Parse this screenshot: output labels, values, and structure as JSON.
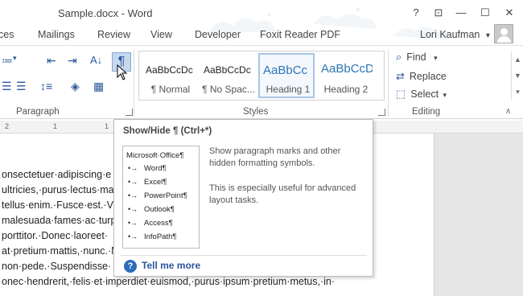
{
  "window": {
    "title": "Sample.docx - Word",
    "help": "?",
    "restore": "⊡",
    "minimize": "—",
    "maximize": "☐",
    "close": "✕"
  },
  "tabs": [
    "ces",
    "Mailings",
    "Review",
    "View",
    "Developer",
    "Foxit Reader PDF"
  ],
  "user": {
    "name": "Lori Kaufman",
    "dropdown": "▾"
  },
  "ribbon": {
    "paragraph_label": "Paragraph",
    "styles_label": "Styles",
    "editing_label": "Editing",
    "pilcrow": "¶",
    "styles": [
      {
        "sample": "AaBbCcDc",
        "name": "¶ Normal"
      },
      {
        "sample": "AaBbCcDc",
        "name": "¶ No Spac..."
      },
      {
        "sample": "AaBbCc",
        "name": "Heading 1"
      },
      {
        "sample": "AaBbCcD",
        "name": "Heading 2"
      }
    ],
    "editing": [
      {
        "icon": "find-icon",
        "label": "Find",
        "arrow": "▾"
      },
      {
        "icon": "replace-icon",
        "label": "Replace"
      },
      {
        "icon": "select-icon",
        "label": "Select",
        "arrow": "▾"
      }
    ]
  },
  "ruler": {
    "marks": [
      "2",
      "1",
      "1"
    ]
  },
  "document": {
    "lines": [
      "onsectetuer·adipiscing·e",
      "ultricies,·purus·lectus·ma",
      "tellus·enim.·Fusce·est.·Viva",
      "malesuada·fames·ac·turpi",
      "porttitor.·Donec·laoreet·",
      "at·pretium·mattis,·nunc.·N",
      "non·pede.·Suspendisse·",
      "onec·hendrerit,·felis·et·imperdiet·euismod,·purus·ipsum·pretium·metus,·in·"
    ]
  },
  "tooltip": {
    "title": "Show/Hide ¶ (Ctrl+*)",
    "preview": {
      "heading": "Microsoft·Office¶",
      "items": [
        "Word¶",
        "Excel¶",
        "PowerPoint¶",
        "Outlook¶",
        "Access¶",
        "InfoPath¶"
      ]
    },
    "desc1": "Show paragraph marks and other hidden formatting symbols.",
    "desc2": "This is especially useful for advanced layout tasks.",
    "tell_more": "Tell me more",
    "help_glyph": "?"
  },
  "colors": {
    "accent": "#2b579a",
    "heading": "#2e74b5"
  }
}
